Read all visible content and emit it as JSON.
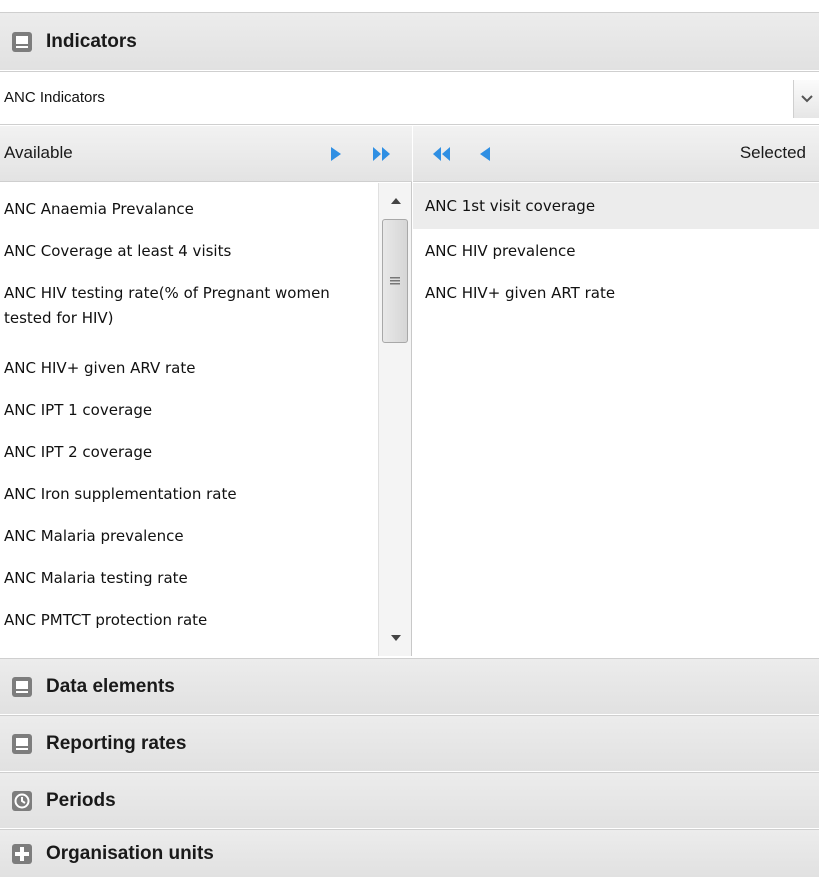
{
  "indicators_panel": {
    "title": "Indicators",
    "icon": "monitor-icon",
    "group_select": {
      "value": "ANC Indicators"
    }
  },
  "available": {
    "label": "Available",
    "items": [
      "ANC Anaemia Prevalance",
      "ANC Coverage at least 4 visits",
      "ANC HIV testing rate(% of Pregnant women tested for HIV)",
      "ANC HIV+ given ARV rate",
      "ANC IPT 1 coverage",
      "ANC IPT 2 coverage",
      "ANC Iron supplementation rate",
      "ANC Malaria prevalence",
      "ANC Malaria testing rate",
      "ANC PMTCT protection rate"
    ]
  },
  "selected": {
    "label": "Selected",
    "items": [
      "ANC 1st visit coverage",
      "ANC HIV prevalence",
      "ANC HIV+ given ART rate"
    ]
  },
  "sections": [
    {
      "title": "Data elements",
      "icon": "monitor-icon"
    },
    {
      "title": "Reporting rates",
      "icon": "monitor-icon"
    },
    {
      "title": "Periods",
      "icon": "clock-icon"
    },
    {
      "title": "Organisation units",
      "icon": "plus-icon"
    }
  ],
  "colors": {
    "accent_blue": "#2f8fe3",
    "header_bg": "#e4e4e4",
    "selected_row": "#ececec"
  }
}
